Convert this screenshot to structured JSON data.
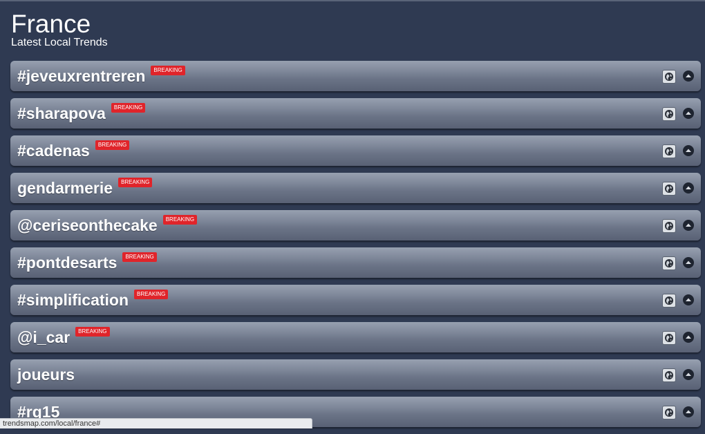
{
  "header": {
    "title": "France",
    "subtitle": "Latest Local Trends"
  },
  "badge_label": "BREAKING",
  "colors": {
    "background": "#2f3a52",
    "badge": "#e0242a"
  },
  "trends": [
    {
      "name": "#jeveuxrentreren",
      "breaking": true
    },
    {
      "name": "#sharapova",
      "breaking": true
    },
    {
      "name": "#cadenas",
      "breaking": true
    },
    {
      "name": "gendarmerie",
      "breaking": true
    },
    {
      "name": "@ceriseonthecake",
      "breaking": true
    },
    {
      "name": "#pontdesarts",
      "breaking": true
    },
    {
      "name": "#simplification",
      "breaking": true
    },
    {
      "name": "@i_car",
      "breaking": true
    },
    {
      "name": "joueurs",
      "breaking": false
    },
    {
      "name": "#rg15",
      "breaking": false
    }
  ],
  "icons": {
    "globe": "globe-icon",
    "collapse": "collapse-up-icon"
  },
  "status_bar": {
    "url": "trendsmap.com/local/france#"
  }
}
